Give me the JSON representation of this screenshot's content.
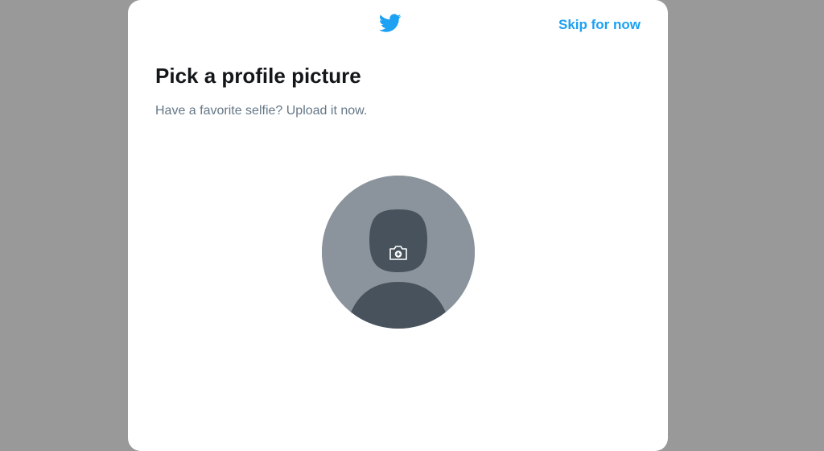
{
  "header": {
    "logo_icon": "twitter-bird-icon",
    "skip_label": "Skip for now"
  },
  "main": {
    "title": "Pick a profile picture",
    "subtitle": "Have a favorite selfie? Upload it now.",
    "avatar": {
      "icon": "add-photo-icon"
    }
  },
  "colors": {
    "brand": "#1da1f2",
    "title_text": "#14171a",
    "secondary_text": "#657786",
    "avatar_bg": "#8b949c",
    "avatar_silhouette": "#47525c",
    "overlay": "#999999"
  }
}
